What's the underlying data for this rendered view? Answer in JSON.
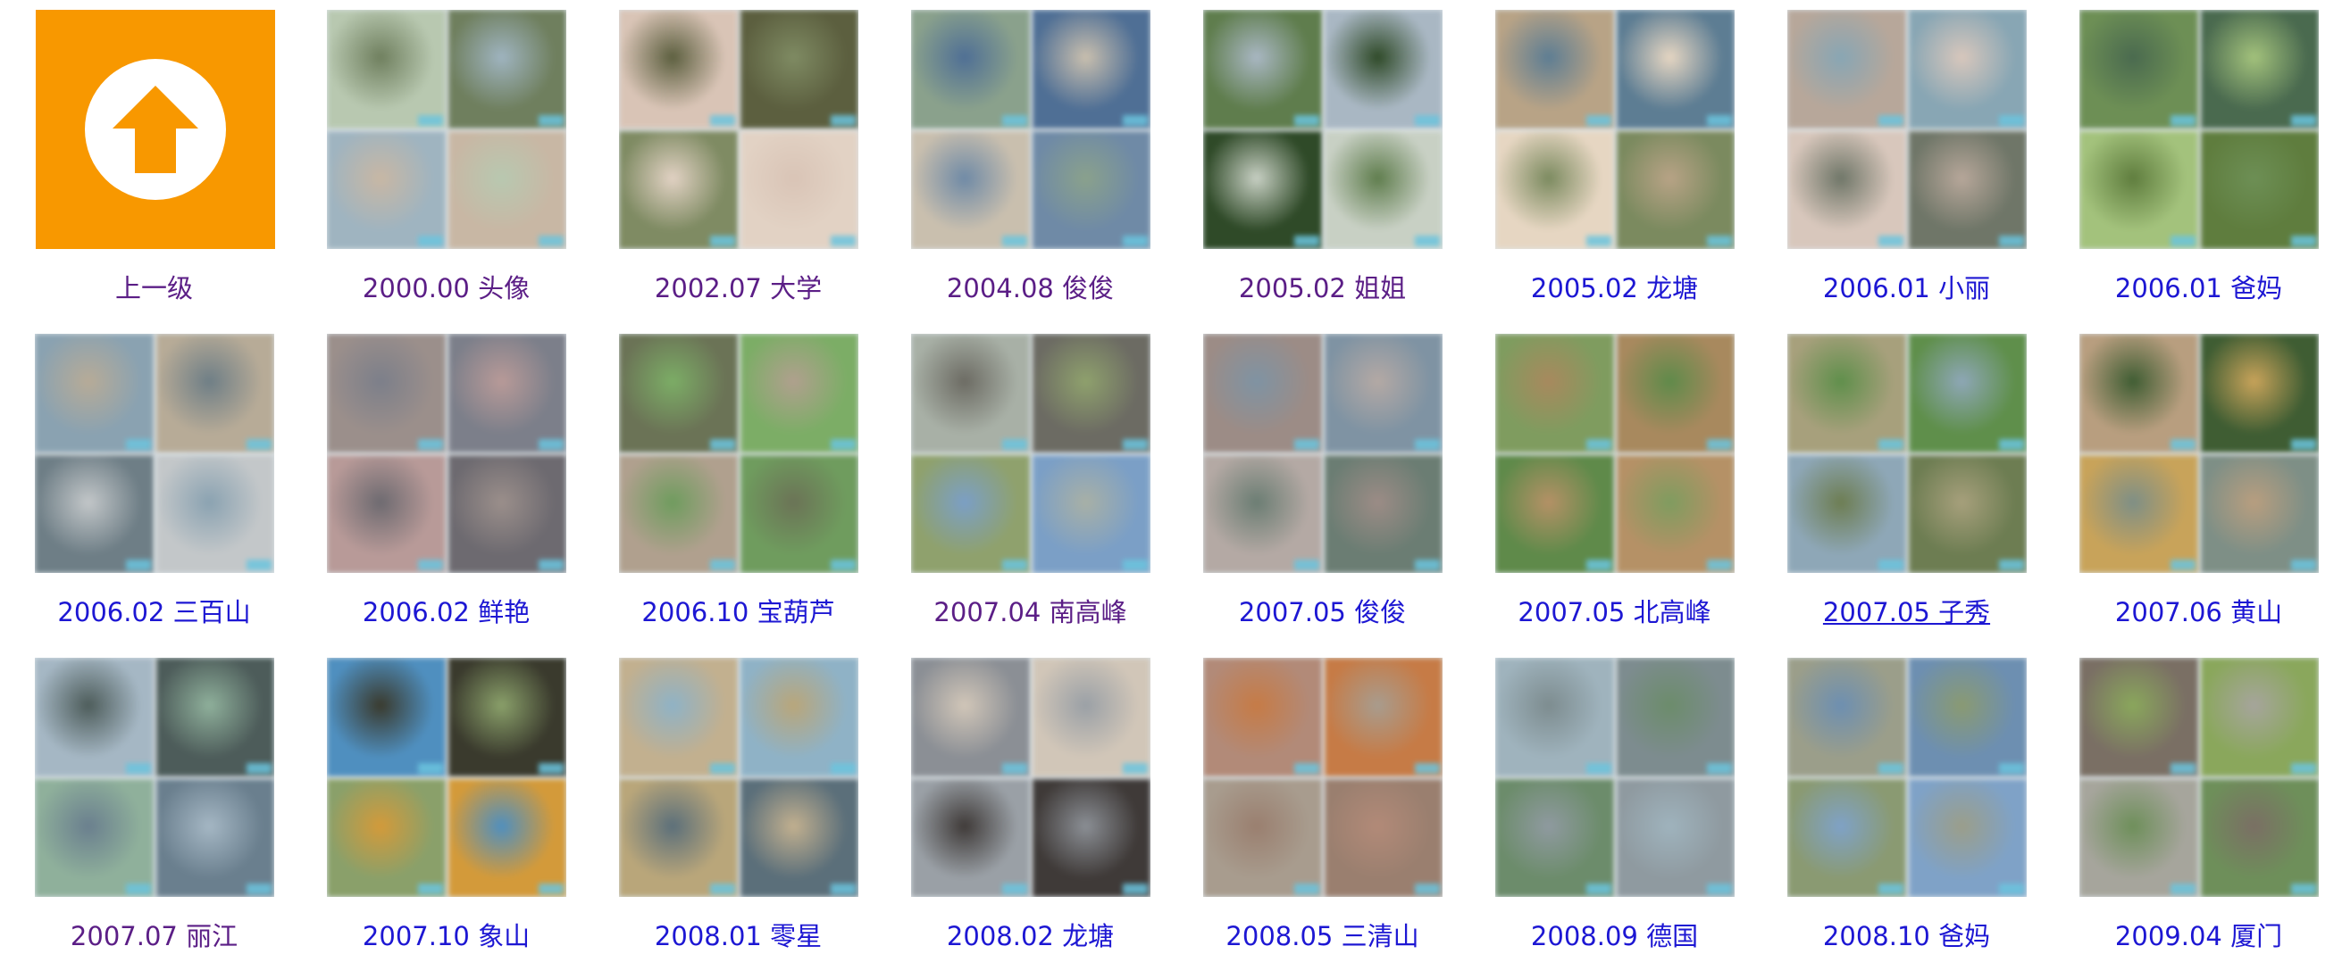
{
  "gallery": {
    "up": {
      "label": "上一级",
      "icon": "up-arrow-icon",
      "tile_color": "#f89800"
    },
    "albums": [
      {
        "label": "2000.00 头像",
        "link_state": "visited"
      },
      {
        "label": "2002.07 大学",
        "link_state": "visited"
      },
      {
        "label": "2004.08 俊俊",
        "link_state": "visited"
      },
      {
        "label": "2005.02 姐姐",
        "link_state": "visited"
      },
      {
        "label": "2005.02 龙塘",
        "link_state": "new"
      },
      {
        "label": "2006.01 小丽",
        "link_state": "new"
      },
      {
        "label": "2006.01 爸妈",
        "link_state": "new"
      },
      {
        "label": "2006.02 三百山",
        "link_state": "new"
      },
      {
        "label": "2006.02 鲜艳",
        "link_state": "new"
      },
      {
        "label": "2006.10 宝葫芦",
        "link_state": "new"
      },
      {
        "label": "2007.04 南高峰",
        "link_state": "visited"
      },
      {
        "label": "2007.05 俊俊",
        "link_state": "new"
      },
      {
        "label": "2007.05 北高峰",
        "link_state": "new"
      },
      {
        "label": "2007.05 子秀",
        "link_state": "hover"
      },
      {
        "label": "2007.06 黄山",
        "link_state": "new"
      },
      {
        "label": "2007.07 丽江",
        "link_state": "visited"
      },
      {
        "label": "2007.10 象山",
        "link_state": "new"
      },
      {
        "label": "2008.01 零星",
        "link_state": "new"
      },
      {
        "label": "2008.02 龙塘",
        "link_state": "new"
      },
      {
        "label": "2008.05 三清山",
        "link_state": "new"
      },
      {
        "label": "2008.09 德国",
        "link_state": "new"
      },
      {
        "label": "2008.10 爸妈",
        "link_state": "new"
      },
      {
        "label": "2009.04 厦门",
        "link_state": "new"
      }
    ],
    "link_colors": {
      "new": "#1d17d3",
      "visited": "#5b1e86"
    }
  }
}
